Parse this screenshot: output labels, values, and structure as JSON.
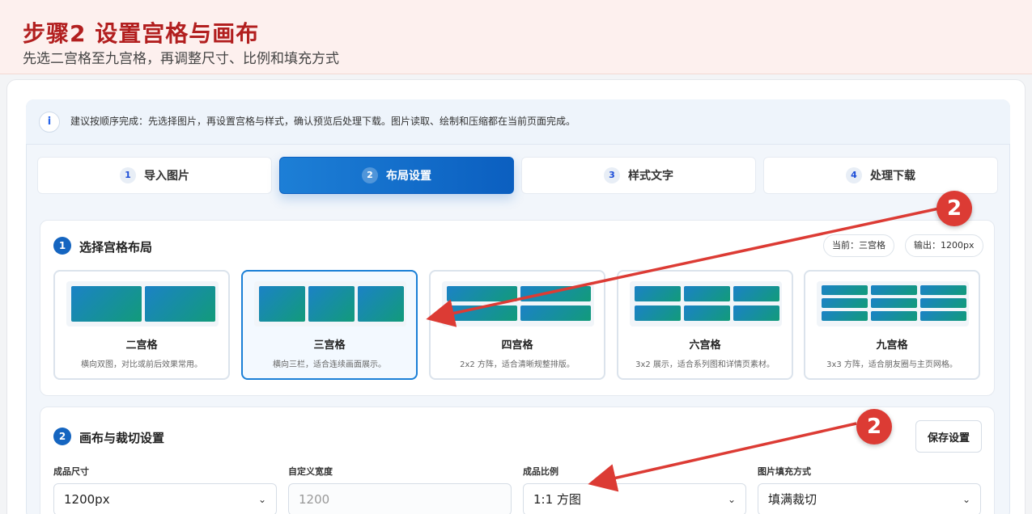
{
  "header": {
    "title": "步骤2 设置宫格与画布",
    "subtitle": "先选二宫格至九宫格，再调整尺寸、比例和填充方式"
  },
  "info": {
    "icon": "i",
    "text": "建议按顺序完成：先选择图片，再设置宫格与样式，确认预览后处理下载。图片读取、绘制和压缩都在当前页面完成。"
  },
  "steps": [
    {
      "num": "1",
      "label": "导入图片"
    },
    {
      "num": "2",
      "label": "布局设置"
    },
    {
      "num": "3",
      "label": "样式文字"
    },
    {
      "num": "4",
      "label": "处理下载"
    }
  ],
  "section1": {
    "num": "1",
    "title": "选择宫格布局",
    "current_pill": "当前：三宫格",
    "output_pill": "输出：1200px"
  },
  "layouts": [
    {
      "title": "二宫格",
      "desc": "横向双图，对比或前后效果常用。"
    },
    {
      "title": "三宫格",
      "desc": "横向三栏，适合连续画面展示。"
    },
    {
      "title": "四宫格",
      "desc": "2x2 方阵，适合清晰规整排版。"
    },
    {
      "title": "六宫格",
      "desc": "3x2 展示，适合系列图和详情页素材。"
    },
    {
      "title": "九宫格",
      "desc": "3x3 方阵，适合朋友圈与主页网格。"
    }
  ],
  "section2": {
    "num": "2",
    "title": "画布与裁切设置",
    "save_label": "保存设置"
  },
  "fields": {
    "size_label": "成品尺寸",
    "size_value": "1200px",
    "width_label": "自定义宽度",
    "width_placeholder": "1200",
    "ratio_label": "成品比例",
    "ratio_value": "1:1 方图",
    "fill_label": "图片填充方式",
    "fill_value": "填满裁切"
  },
  "annotations": {
    "badge1": "2",
    "badge2": "2",
    "arrow_color": "#dc3b34"
  }
}
